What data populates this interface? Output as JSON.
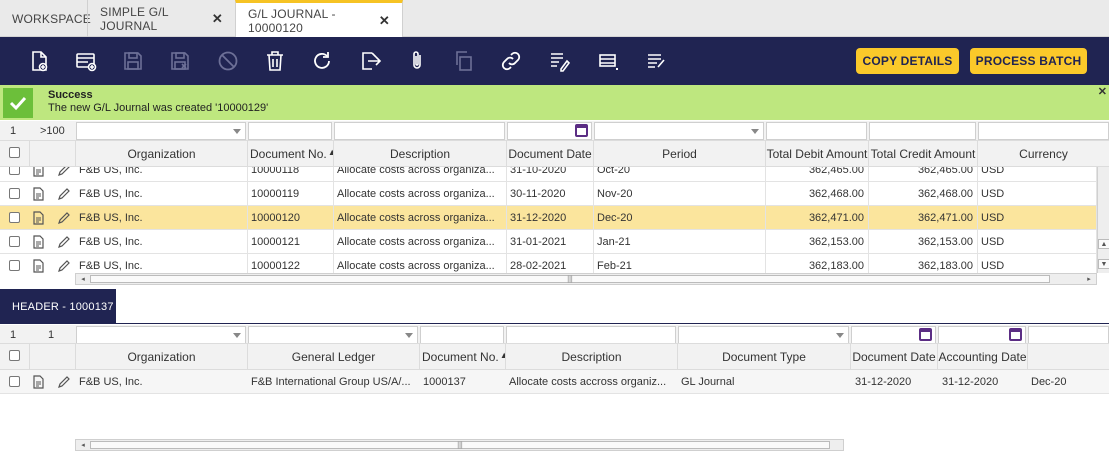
{
  "tabs": [
    {
      "label": "WORKSPACE",
      "closable": false,
      "active": false
    },
    {
      "label": "SIMPLE G/L JOURNAL",
      "closable": true,
      "active": false
    },
    {
      "label": "G/L JOURNAL - 10000120",
      "closable": true,
      "active": true
    }
  ],
  "toolbar": {
    "icons": [
      "new-document-icon",
      "new-record-icon",
      "save-icon",
      "save-and-close-icon",
      "undo-icon",
      "delete-icon",
      "refresh-icon",
      "export-icon",
      "attach-icon",
      "copy-icon",
      "link-icon",
      "notes-icon",
      "grid-view-icon",
      "audit-icon"
    ],
    "copy_details": "COPY DETAILS",
    "process_batch": "PROCESS BATCH"
  },
  "message": {
    "title": "Success",
    "text": "The new G/L Journal was created '10000129'"
  },
  "top_grid": {
    "selected_count": "1",
    "row_count": ">100",
    "columns": [
      "Organization",
      "Document No.",
      "Description",
      "Document Date",
      "Period",
      "Total Debit Amount",
      "Total Credit Amount",
      "Currency"
    ],
    "rows": [
      {
        "organization": "F&B US, Inc.",
        "document_no": "10000118",
        "description": "Allocate costs across organiza...",
        "document_date": "31-10-2020",
        "period": "Oct-20",
        "debit": "362,465.00",
        "credit": "362,465.00",
        "currency": "USD"
      },
      {
        "organization": "F&B US, Inc.",
        "document_no": "10000119",
        "description": "Allocate costs across organiza...",
        "document_date": "30-11-2020",
        "period": "Nov-20",
        "debit": "362,468.00",
        "credit": "362,468.00",
        "currency": "USD"
      },
      {
        "organization": "F&B US, Inc.",
        "document_no": "10000120",
        "description": "Allocate costs across organiza...",
        "document_date": "31-12-2020",
        "period": "Dec-20",
        "debit": "362,471.00",
        "credit": "362,471.00",
        "currency": "USD"
      },
      {
        "organization": "F&B US, Inc.",
        "document_no": "10000121",
        "description": "Allocate costs across organiza...",
        "document_date": "31-01-2021",
        "period": "Jan-21",
        "debit": "362,153.00",
        "credit": "362,153.00",
        "currency": "USD"
      },
      {
        "organization": "F&B US, Inc.",
        "document_no": "10000122",
        "description": "Allocate costs across organiza...",
        "document_date": "28-02-2021",
        "period": "Feb-21",
        "debit": "362,183.00",
        "credit": "362,183.00",
        "currency": "USD"
      }
    ]
  },
  "header_section": {
    "title": "HEADER - 1000137",
    "selected_count": "1",
    "row_count": "1",
    "columns": [
      "Organization",
      "General Ledger",
      "Document No.",
      "Description",
      "Document Type",
      "Document Date",
      "Accounting Date"
    ],
    "rows": [
      {
        "organization": "F&B US, Inc.",
        "general_ledger": "F&B International Group US/A/...",
        "document_no": "1000137",
        "description": "Allocate costs accross organiz...",
        "document_type": "GL Journal",
        "document_date": "31-12-2020",
        "accounting_date": "31-12-2020",
        "period": "Dec-20"
      }
    ]
  },
  "colors": {
    "navy": "#202452",
    "accent": "#fbc92a",
    "success": "#bee77f",
    "selected_row": "#fbe59d"
  }
}
